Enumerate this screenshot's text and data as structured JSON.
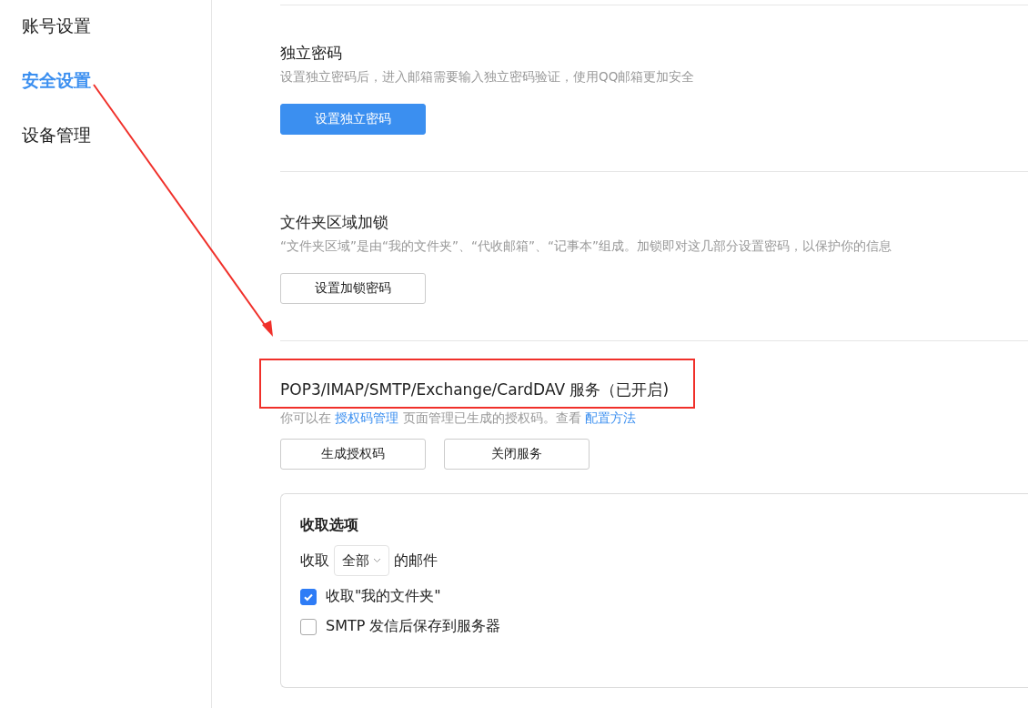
{
  "sidebar": {
    "items": [
      {
        "label": "账号设置",
        "selected": false
      },
      {
        "label": "安全设置",
        "selected": true
      },
      {
        "label": "设备管理",
        "selected": false
      }
    ]
  },
  "sections": [
    {
      "title": "独立密码",
      "description": "设置独立密码后，进入邮箱需要输入独立密码验证，使用QQ邮箱更加安全",
      "buttons": [
        {
          "label": "设置独立密码",
          "kind": "primary"
        }
      ]
    },
    {
      "title": "文件夹区域加锁",
      "description": "“文件夹区域”是由“我的文件夹”、“代收邮箱”、“记事本”组成。加锁即对这几部分设置密码，以保护你的信息",
      "buttons": [
        {
          "label": "设置加锁密码",
          "kind": "default"
        }
      ]
    },
    {
      "title": "POP3/IMAP/SMTP/Exchange/CardDAV 服务（已开启)",
      "hint": [
        {
          "kind": "text",
          "text": "你可以在"
        },
        {
          "kind": "link",
          "text": "授权码管理"
        },
        {
          "kind": "text",
          "text": "页面管理已生成的授权码。查看"
        },
        {
          "kind": "link",
          "text": "配置方法"
        }
      ],
      "buttons": [
        {
          "label": "生成授权码",
          "kind": "default"
        },
        {
          "label": "关闭服务",
          "kind": "default"
        }
      ],
      "options": {
        "title": "收取选项",
        "fetch_prefix": "收取",
        "fetch_select": "全部",
        "fetch_suffix": "的邮件",
        "checkboxes": [
          {
            "label": "收取\"我的文件夹\"",
            "checked": true
          },
          {
            "label": "SMTP 发信后保存到服务器",
            "checked": false
          }
        ]
      }
    }
  ]
}
